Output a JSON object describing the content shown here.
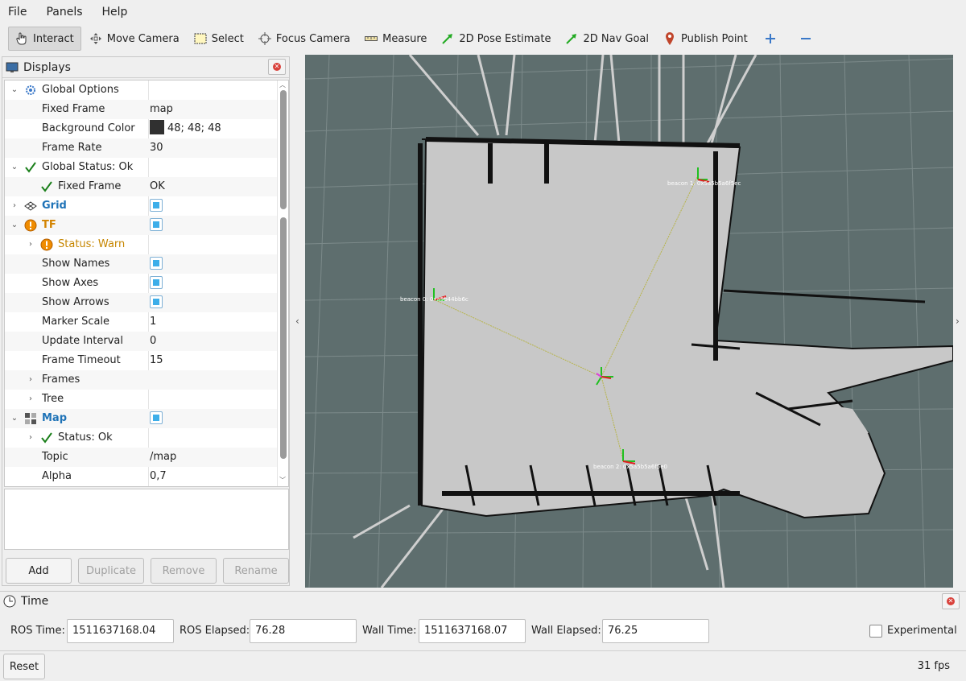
{
  "menu": [
    "File",
    "Panels",
    "Help"
  ],
  "toolbar": [
    {
      "label": "Interact",
      "icon": "hand-cursor-icon",
      "active": true
    },
    {
      "label": "Move Camera",
      "icon": "move-camera-icon"
    },
    {
      "label": "Select",
      "icon": "select-box-icon"
    },
    {
      "label": "Focus Camera",
      "icon": "focus-target-icon"
    },
    {
      "label": "Measure",
      "icon": "ruler-icon"
    },
    {
      "label": "2D Pose Estimate",
      "icon": "green-arrow-icon"
    },
    {
      "label": "2D Nav Goal",
      "icon": "green-arrow-icon"
    },
    {
      "label": "Publish Point",
      "icon": "map-pin-icon"
    }
  ],
  "displays": {
    "title": "Displays",
    "rows": [
      {
        "name": "Global Options",
        "value": "",
        "indent": 0,
        "expand": "open",
        "icon": "gear-icon"
      },
      {
        "name": "Fixed Frame",
        "value": "map",
        "indent": 1
      },
      {
        "name": "Background Color",
        "value": "48; 48; 48",
        "indent": 1,
        "swatch": "#303030"
      },
      {
        "name": "Frame Rate",
        "value": "30",
        "indent": 1
      },
      {
        "name": "Global Status: Ok",
        "value": "",
        "indent": 0,
        "expand": "open",
        "icon": "check-icon"
      },
      {
        "name": "Fixed Frame",
        "value": "OK",
        "indent": 1,
        "icon": "check-icon"
      },
      {
        "name": "Grid",
        "value": "",
        "indent": 0,
        "expand": "closed",
        "icon": "grid-icon",
        "style": "blue",
        "checkbox": true
      },
      {
        "name": "TF",
        "value": "",
        "indent": 0,
        "expand": "open",
        "icon": "warning-icon",
        "style": "orange",
        "checkbox": true
      },
      {
        "name": "Status: Warn",
        "value": "",
        "indent": 1,
        "expand": "closed",
        "icon": "warning-icon",
        "style": "warn"
      },
      {
        "name": "Show Names",
        "value": "",
        "indent": 1,
        "checkbox": true
      },
      {
        "name": "Show Axes",
        "value": "",
        "indent": 1,
        "checkbox": true
      },
      {
        "name": "Show Arrows",
        "value": "",
        "indent": 1,
        "checkbox": true
      },
      {
        "name": "Marker Scale",
        "value": "1",
        "indent": 1
      },
      {
        "name": "Update Interval",
        "value": "0",
        "indent": 1
      },
      {
        "name": "Frame Timeout",
        "value": "15",
        "indent": 1
      },
      {
        "name": "Frames",
        "value": "",
        "indent": 1,
        "expand": "closed"
      },
      {
        "name": "Tree",
        "value": "",
        "indent": 1,
        "expand": "closed"
      },
      {
        "name": "Map",
        "value": "",
        "indent": 0,
        "expand": "open",
        "icon": "map-icon",
        "style": "blue",
        "checkbox": true
      },
      {
        "name": "Status: Ok",
        "value": "",
        "indent": 1,
        "expand": "closed",
        "icon": "check-icon"
      },
      {
        "name": "Topic",
        "value": "/map",
        "indent": 1
      },
      {
        "name": "Alpha",
        "value": "0,7",
        "indent": 1
      }
    ],
    "buttons": {
      "add": "Add",
      "duplicate": "Duplicate",
      "remove": "Remove",
      "rename": "Rename"
    }
  },
  "viewport": {
    "bg_color": "#5e6e6e",
    "beacon_labels": [
      "beacon 0: 0xa5b44bb6c",
      "beacon 1: 0x5a5b5a6f5ec",
      "beacon 2: 0x5a5b5a6f5e0"
    ]
  },
  "time": {
    "title": "Time",
    "ros_time_label": "ROS Time:",
    "ros_time": "1511637168.04",
    "ros_elapsed_label": "ROS Elapsed:",
    "ros_elapsed": "76.28",
    "wall_time_label": "Wall Time:",
    "wall_time": "1511637168.07",
    "wall_elapsed_label": "Wall Elapsed:",
    "wall_elapsed": "76.25",
    "experimental": "Experimental"
  },
  "status": {
    "reset": "Reset",
    "fps": "31 fps"
  }
}
